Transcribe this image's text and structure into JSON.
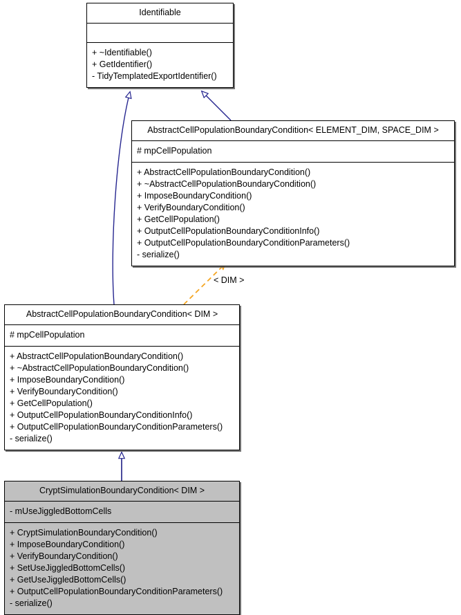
{
  "diagram": {
    "type": "uml-class-diagram",
    "title": "CryptSimulationBoundaryCondition inheritance diagram",
    "colors": {
      "inheritance_edge": "#25258f",
      "template_edge": "#f5a623",
      "node_fill": "#ffffff",
      "node_fill_highlight": "#c0c0c0",
      "node_border": "#000000",
      "shadow": "#5a5a5a"
    }
  },
  "nodes": [
    {
      "id": "identifiable",
      "title": "Identifiable",
      "attributes": [],
      "operations": [
        "+ ~Identifiable()",
        "+ GetIdentifier()",
        "- TidyTemplatedExportIdentifier()"
      ],
      "highlighted": false
    },
    {
      "id": "abstract_template",
      "title": "AbstractCellPopulationBoundaryCondition< ELEMENT_DIM, SPACE_DIM >",
      "attributes": [
        "# mpCellPopulation"
      ],
      "operations": [
        "+ AbstractCellPopulationBoundaryCondition()",
        "+ ~AbstractCellPopulationBoundaryCondition()",
        "+ ImposeBoundaryCondition()",
        "+ VerifyBoundaryCondition()",
        "+ GetCellPopulation()",
        "+ OutputCellPopulationBoundaryConditionInfo()",
        "+ OutputCellPopulationBoundaryConditionParameters()",
        "- serialize()"
      ],
      "highlighted": false
    },
    {
      "id": "abstract_dim",
      "title": "AbstractCellPopulationBoundaryCondition< DIM >",
      "attributes": [
        "# mpCellPopulation"
      ],
      "operations": [
        "+ AbstractCellPopulationBoundaryCondition()",
        "+ ~AbstractCellPopulationBoundaryCondition()",
        "+ ImposeBoundaryCondition()",
        "+ VerifyBoundaryCondition()",
        "+ GetCellPopulation()",
        "+ OutputCellPopulationBoundaryConditionInfo()",
        "+ OutputCellPopulationBoundaryConditionParameters()",
        "- serialize()"
      ],
      "highlighted": false
    },
    {
      "id": "crypt_sim",
      "title": "CryptSimulationBoundaryCondition< DIM >",
      "attributes": [
        "- mUseJiggledBottomCells"
      ],
      "operations": [
        "+ CryptSimulationBoundaryCondition()",
        "+ ImposeBoundaryCondition()",
        "+ VerifyBoundaryCondition()",
        "+ SetUseJiggledBottomCells()",
        "+ GetUseJiggledBottomCells()",
        "+ OutputCellPopulationBoundaryConditionParameters()",
        "- serialize()"
      ],
      "highlighted": true
    }
  ],
  "edges": [
    {
      "id": "edge-abstract-dim-to-identifiable",
      "kind": "inheritance",
      "from": "abstract_dim",
      "to": "identifiable",
      "label": ""
    },
    {
      "id": "edge-abstract-template-to-identifiable",
      "kind": "inheritance",
      "from": "abstract_template",
      "to": "identifiable",
      "label": ""
    },
    {
      "id": "edge-abstract-dim-to-abstract-template",
      "kind": "template-binding",
      "from": "abstract_dim",
      "to": "abstract_template",
      "label": "< DIM >"
    },
    {
      "id": "edge-crypt-to-abstract-dim",
      "kind": "inheritance",
      "from": "crypt_sim",
      "to": "abstract_dim",
      "label": ""
    }
  ]
}
